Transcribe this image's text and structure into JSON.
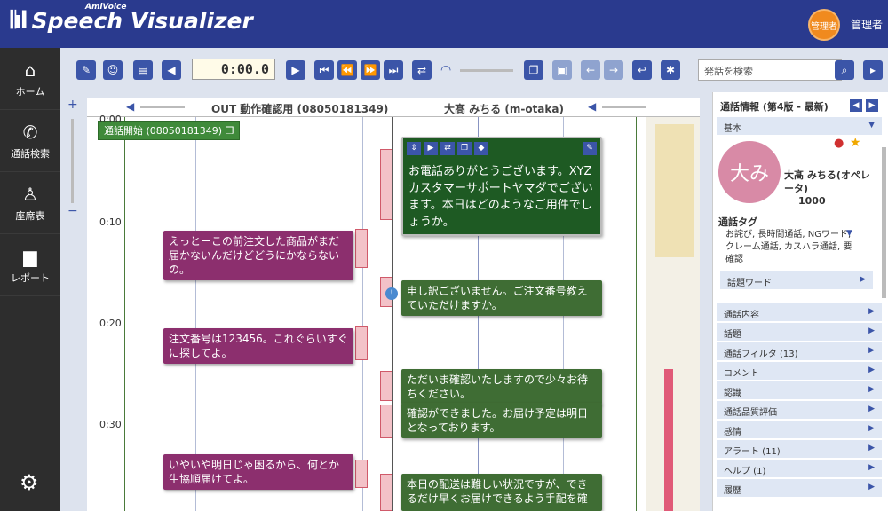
{
  "header": {
    "logo_sub": "AmiVoice",
    "logo": "Speech Visualizer",
    "badge": "管理者",
    "user": "管理者"
  },
  "sidebar": {
    "items": [
      {
        "label": "ホーム"
      },
      {
        "label": "通話検索"
      },
      {
        "label": "座席表"
      },
      {
        "label": "レポート"
      }
    ]
  },
  "toolbar": {
    "time": "0:00.0",
    "search_placeholder": "発話を検索"
  },
  "channels": {
    "out": "OUT 動作確認用 (08050181349)",
    "in": "大髙 みちる (m-otaka)"
  },
  "call_start": "通話開始 (08050181349)",
  "times": [
    "0:00",
    "0:10",
    "0:20",
    "0:30"
  ],
  "bubbles": {
    "p1": "えっとーこの前注文した商品がまだ届かないんだけどどうにかならないの。",
    "p2": "注文番号は123456。これぐらいすぐに探してよ。",
    "p3": "いやいや明日じゃ困るから、何とか生協順届けてよ。",
    "g0": "お電話ありがとうございます。XYZ カスタマーサポートヤマダでございます。本日はどのようなご用件でしょうか。",
    "g1": "申し訳ございません。ご注文番号教えていただけますか。",
    "g2": "ただいま確認いたしますので少々お待ちください。",
    "g3": "確認ができました。お届け予定は明日となっております。",
    "g4": "本日の配送は難しい状況ですが、できるだけ早くお届けできるよう手配を確"
  },
  "panel": {
    "title": "通話情報 (第4版 - 最新)",
    "basic": "基本",
    "avatar": "大み",
    "agent": "大髙 みちる(オペレータ)",
    "agent_id": "1000",
    "tags_label": "通話タグ",
    "tags": "お詫び, 長時間通話, NGワード, クレーム通話, カスハラ通話, 要確認",
    "rows": [
      "話題ワード",
      "通話内容",
      "話題",
      "通話フィルタ (13)",
      "コメント",
      "認識",
      "通話品質評価",
      "感情",
      "アラート (11)",
      "ヘルプ (1)",
      "履歴"
    ]
  }
}
